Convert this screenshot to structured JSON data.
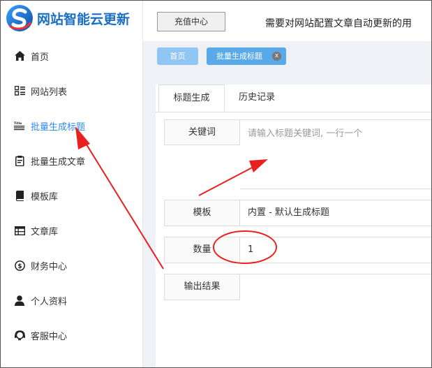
{
  "brand": {
    "name": "网站智能云更新"
  },
  "sidebar": {
    "items": [
      {
        "label": "首页",
        "icon": "home-icon"
      },
      {
        "label": "网站列表",
        "icon": "list-icon"
      },
      {
        "label": "批量生成标题",
        "icon": "title-icon",
        "icon_text": "Title",
        "active": true
      },
      {
        "label": "批量生成文章",
        "icon": "document-icon"
      },
      {
        "label": "模板库",
        "icon": "book-icon"
      },
      {
        "label": "文章库",
        "icon": "table-icon"
      },
      {
        "label": "财务中心",
        "icon": "dollar-icon"
      },
      {
        "label": "个人资料",
        "icon": "user-icon"
      },
      {
        "label": "客服中心",
        "icon": "support-icon"
      }
    ]
  },
  "topbar": {
    "recharge_label": "充值中心",
    "notice": "需要对网站配置文章自动更新的用"
  },
  "tabs": {
    "home": "首页",
    "current": "批量生成标题",
    "close": "x"
  },
  "form": {
    "subtabs": [
      "标题生成",
      "历史记录"
    ],
    "keyword_label": "关键词",
    "keyword_placeholder": "请输入标题关键词, 一行一个",
    "template_label": "模板",
    "template_value": "内置 - 默认生成标题",
    "quantity_label": "数量",
    "quantity_value": "1",
    "output_label": "输出结果"
  },
  "colors": {
    "accent": "#2d8cf0",
    "brand": "#1a6fc4",
    "annotation": "#e8201e"
  }
}
